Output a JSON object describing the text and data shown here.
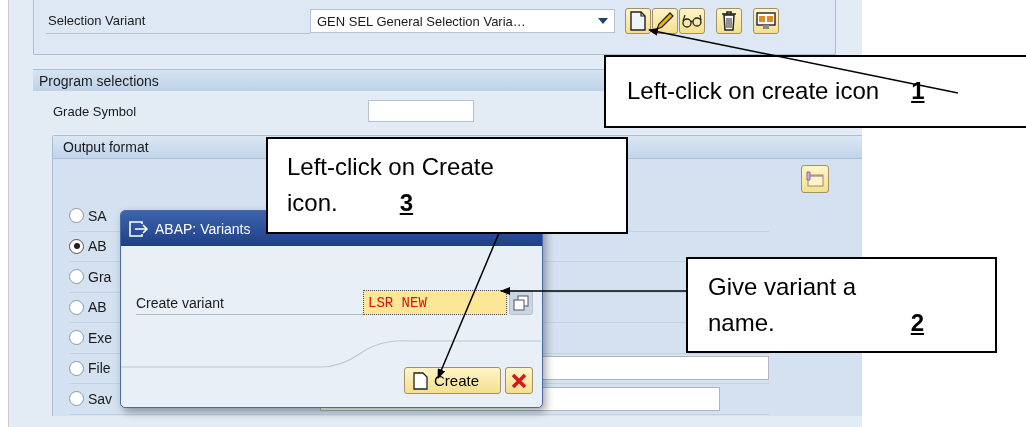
{
  "selection_variant": {
    "label": "Selection Variant",
    "value": "GEN SEL General Selection Varia…"
  },
  "program_selections": {
    "title": "Program selections",
    "grade_symbol": {
      "label": "Grade Symbol"
    }
  },
  "output_format": {
    "title": "Output format",
    "options": [
      {
        "label": "SA",
        "selected": false
      },
      {
        "label": "AB",
        "selected": true
      },
      {
        "label": "Gra",
        "selected": false
      },
      {
        "label": "AB",
        "selected": false
      },
      {
        "label": "Exe",
        "selected": false
      },
      {
        "label": "File",
        "selected": false
      },
      {
        "label": "Sav",
        "selected": false
      }
    ]
  },
  "dialog": {
    "title": "ABAP: Variants",
    "field_label": "Create variant",
    "field_value": "LSR NEW",
    "create_button": "Create"
  },
  "callouts": [
    {
      "lines": [
        "Left-click on create icon"
      ],
      "number": "1"
    },
    {
      "lines": [
        "Give variant a",
        "name."
      ],
      "number": "2"
    },
    {
      "lines": [
        "Left-click on Create",
        "icon."
      ],
      "number": "3"
    }
  ]
}
